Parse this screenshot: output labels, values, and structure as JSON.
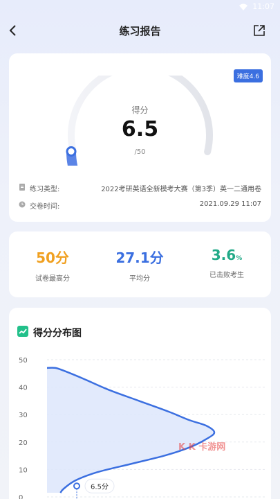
{
  "status": {
    "time": "11:07"
  },
  "nav": {
    "title": "练习报告"
  },
  "report": {
    "difficulty": "难度4.6",
    "score_label": "得分",
    "score_value": "6.5",
    "score_total": "/50",
    "score_fraction": 0.13,
    "type_label": "练习类型:",
    "type_value": "2022考研英语全新模考大赛（第3季）英一二通用卷",
    "time_label": "交卷时间:",
    "time_value": "2021.09.29 11:07"
  },
  "stats": {
    "max_value": "50分",
    "max_label": "试卷最高分",
    "avg_value": "27.1分",
    "avg_label": "平均分",
    "beat_value": "3.6",
    "beat_unit": "%",
    "beat_label": "已击败考生"
  },
  "chart_header": {
    "title": "得分分布图"
  },
  "watermark": "K    K 卡游网",
  "chart_data": {
    "type": "area",
    "title": "得分分布图",
    "xlabel": "",
    "ylabel": "",
    "yticks": [
      0,
      10,
      20,
      30,
      40,
      50
    ],
    "ylim": [
      0,
      50
    ],
    "ytick_labels": [
      "0",
      "10",
      "20",
      "30",
      "40",
      "50"
    ],
    "x": [
      0.0,
      0.05,
      0.1,
      0.22,
      0.37,
      0.55,
      0.73,
      0.85,
      0.95,
      1.0,
      0.95,
      0.85,
      0.7,
      0.5,
      0.3,
      0.17,
      0.1,
      0.08
    ],
    "y": [
      47,
      47,
      46,
      43,
      39,
      35,
      31,
      28,
      26,
      23.5,
      21,
      18,
      15,
      12,
      9,
      6,
      3,
      1.5
    ],
    "marker": {
      "score": 6.5,
      "label": "6.5分"
    },
    "colors": {
      "line": "#3b6fe0",
      "fill": "#dde6fb"
    }
  }
}
